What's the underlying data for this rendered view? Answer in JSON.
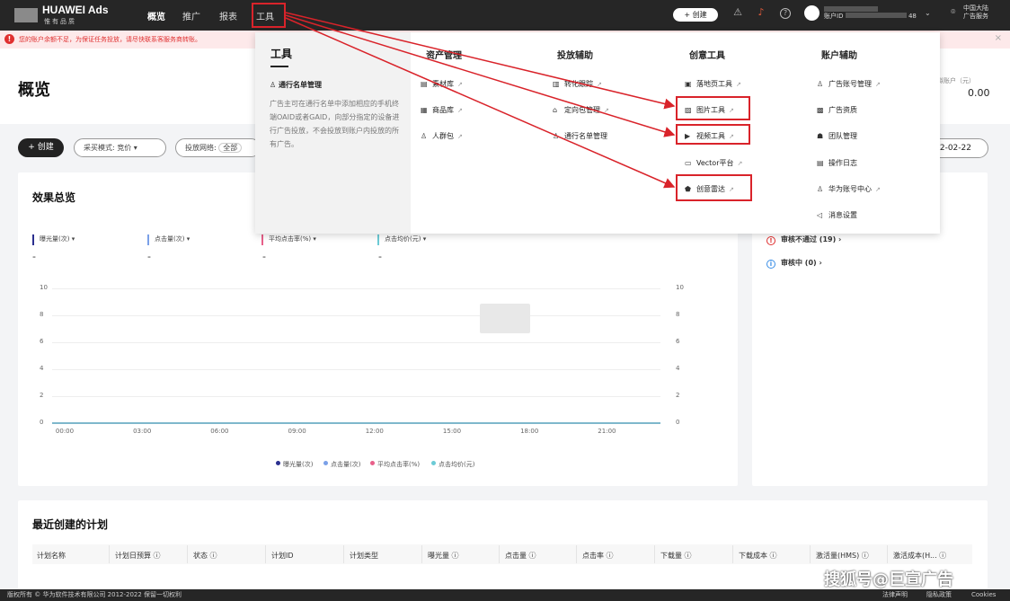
{
  "brand": {
    "title": "HUAWEI Ads",
    "subtitle": "惟有品质"
  },
  "nav": {
    "items": [
      "概览",
      "推广",
      "报表",
      "工具"
    ],
    "active": "概览",
    "highlighted": "工具"
  },
  "topbar": {
    "create_label": "+ 创建",
    "icons": [
      "warning-triangle-icon",
      "bell-icon",
      "help-icon"
    ],
    "account_id_label": "账户ID",
    "account_id_suffix": "48",
    "region_line1": "中国大陆",
    "region_line2": "广告服务"
  },
  "alert": {
    "text": "您的账户余额不足，为保证任务投放，请尽快联系客服务商转账。"
  },
  "page": {
    "title": "概览",
    "virtual_label": "虚拟账户（元）",
    "virtual_value": "0.00"
  },
  "filters": {
    "create_label": "+ 创建",
    "buy_mode": "采买模式: 竞价",
    "network": "投放网络:",
    "network_value": "全部",
    "date_end": "2-02-22"
  },
  "effects": {
    "title": "效果总览",
    "metrics": [
      {
        "label": "曝光量(次)",
        "value": "-",
        "color": "#2b2f8f"
      },
      {
        "label": "点击量(次)",
        "value": "-",
        "color": "#7aa0e8"
      },
      {
        "label": "平均点击率(%)",
        "value": "-",
        "color": "#e8608a"
      },
      {
        "label": "点击均价(元)",
        "value": "-",
        "color": "#6ccbd6"
      }
    ]
  },
  "chart_data": {
    "type": "line",
    "x": [
      "00:00",
      "03:00",
      "06:00",
      "09:00",
      "12:00",
      "15:00",
      "18:00",
      "21:00"
    ],
    "yticks": [
      0,
      2,
      4,
      6,
      8,
      10
    ],
    "ylim": [
      0,
      10
    ],
    "series": [
      {
        "name": "曝光量(次)",
        "color": "#2b2f8f",
        "values": [
          0,
          0,
          0,
          0,
          0,
          0,
          0,
          0
        ]
      },
      {
        "name": "点击量(次)",
        "color": "#7aa0e8",
        "values": [
          0,
          0,
          0,
          0,
          0,
          0,
          0,
          0
        ]
      },
      {
        "name": "平均点击率(%)",
        "color": "#e8608a",
        "values": [
          0,
          0,
          0,
          0,
          0,
          0,
          0,
          0
        ]
      },
      {
        "name": "点击均价(元)",
        "color": "#6ccbd6",
        "values": [
          0,
          0,
          0,
          0,
          0,
          0,
          0,
          0
        ]
      }
    ],
    "legend": "bottom"
  },
  "review": {
    "failed": "审核不通过 (19)",
    "pending": "审核中 (0)"
  },
  "recent": {
    "title": "最近创建的计划",
    "columns": [
      "计划名称",
      "计划日预算",
      "状态",
      "计划ID",
      "计划类型",
      "曝光量",
      "点击量",
      "点击率",
      "下载量",
      "下载成本",
      "激活量(HMS)",
      "激活成本(H..."
    ]
  },
  "footer": {
    "copyright": "版权所有 © 华为软件技术有限公司 2012-2022 保留一切权利",
    "links": [
      "法律声明",
      "隐私政策",
      "Cookies"
    ]
  },
  "dropdown": {
    "title": "工具",
    "subtitle": "通行名单管理",
    "description": "广告主可在通行名单中添加相应的手机终端OAID或者GAID，向部分指定的设备进行广告投放，不会投放到账户内投放的所有广告。",
    "columns": [
      {
        "heading": "资产管理",
        "items": [
          {
            "label": "素材库",
            "icon": "folder-icon"
          },
          {
            "label": "商品库",
            "icon": "box-icon"
          },
          {
            "label": "人群包",
            "icon": "people-icon"
          }
        ]
      },
      {
        "heading": "投放辅助",
        "items": [
          {
            "label": "转化跟踪",
            "icon": "chart-icon"
          },
          {
            "label": "定向包管理",
            "icon": "home-icon"
          },
          {
            "label": "通行名单管理",
            "icon": "user-icon"
          }
        ]
      },
      {
        "heading": "创意工具",
        "items": [
          {
            "label": "落地页工具",
            "icon": "page-icon"
          },
          {
            "label": "图片工具",
            "icon": "image-icon"
          },
          {
            "label": "视频工具",
            "icon": "video-icon"
          },
          {
            "label": "Vector平台",
            "icon": "monitor-icon"
          },
          {
            "label": "创意雷达",
            "icon": "radar-icon"
          }
        ]
      },
      {
        "heading": "账户辅助",
        "items": [
          {
            "label": "广告账号管理",
            "icon": "user-icon"
          },
          {
            "label": "广告资质",
            "icon": "certificate-icon"
          },
          {
            "label": "团队管理",
            "icon": "team-icon"
          },
          {
            "label": "操作日志",
            "icon": "log-icon"
          },
          {
            "label": "华为账号中心",
            "icon": "account-icon"
          },
          {
            "label": "消息设置",
            "icon": "speaker-icon"
          }
        ]
      }
    ]
  },
  "watermark": "搜狐号@巨宣广告"
}
